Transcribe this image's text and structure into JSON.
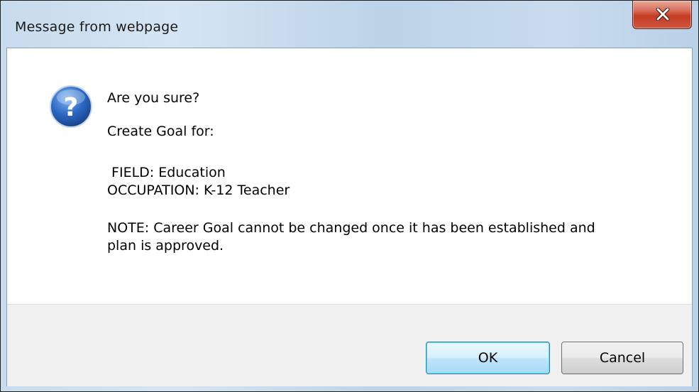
{
  "window": {
    "title": "Message from webpage"
  },
  "close_button": {
    "icon": "close-x-icon"
  },
  "dialog": {
    "icon": "question-icon",
    "lines": {
      "question": "Are you sure?",
      "create_goal": "Create Goal for:",
      "field": " FIELD: Education",
      "occupation": "OCCUPATION: K-12 Teacher",
      "note_line1": "NOTE: Career Goal cannot be changed once it has been established and",
      "note_line2": "plan is approved."
    }
  },
  "buttons": {
    "ok_label": "OK",
    "cancel_label": "Cancel"
  },
  "colors": {
    "close_button": "#c43b22",
    "icon_blue": "#1f58a8",
    "footer_bg": "#f0f0f0"
  }
}
